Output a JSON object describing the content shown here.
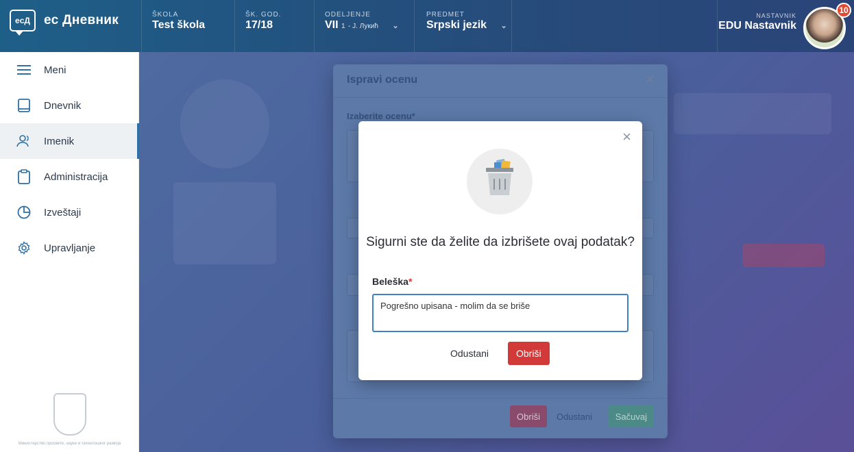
{
  "app": {
    "logo_mark": "ecД",
    "name": "ес Дневник"
  },
  "header": {
    "school": {
      "label": "ŠKOLA",
      "value": "Test škola"
    },
    "year": {
      "label": "ŠK. GOD.",
      "value": "17/18"
    },
    "class": {
      "label": "ODELJENJE",
      "value": "VII",
      "sub": "1",
      "teacher": "- J. Лукић"
    },
    "subject": {
      "label": "PREDMET",
      "value": "Srpski jezik"
    },
    "user": {
      "label": "NASTAVNIK",
      "name": "EDU Nastavnik",
      "notifications": "10"
    },
    "colors": {
      "bar_start": "#1e5f88",
      "bar_end": "#2b4478"
    }
  },
  "sidebar": {
    "items": [
      {
        "label": "Meni",
        "icon": "hamburger-icon"
      },
      {
        "label": "Dnevnik",
        "icon": "book-icon"
      },
      {
        "label": "Imenik",
        "icon": "users-icon",
        "active": true
      },
      {
        "label": "Administracija",
        "icon": "clipboard-icon"
      },
      {
        "label": "Izveštaji",
        "icon": "pie-chart-icon"
      },
      {
        "label": "Upravljanje",
        "icon": "gear-icon"
      }
    ],
    "footer_text": "Министарство просвете, науке и технолошког развоја"
  },
  "edit_modal": {
    "title": "Ispravi ocenu",
    "grade_label": "Izaberite ocenu*",
    "delete_label": "Obriši",
    "cancel_label": "Odustani",
    "save_label": "Sačuvaj"
  },
  "confirm_dialog": {
    "question": "Sigurni ste da želite da izbrišete ovaj podatak?",
    "note_label": "Beleška",
    "note_required": "*",
    "note_value": "Pogrešno upisana - molim da se briše",
    "cancel_label": "Odustani",
    "delete_label": "Obriši",
    "icon": "trash-icon",
    "colors": {
      "delete": "#d23a3a",
      "focus": "#3f7fc4"
    }
  }
}
